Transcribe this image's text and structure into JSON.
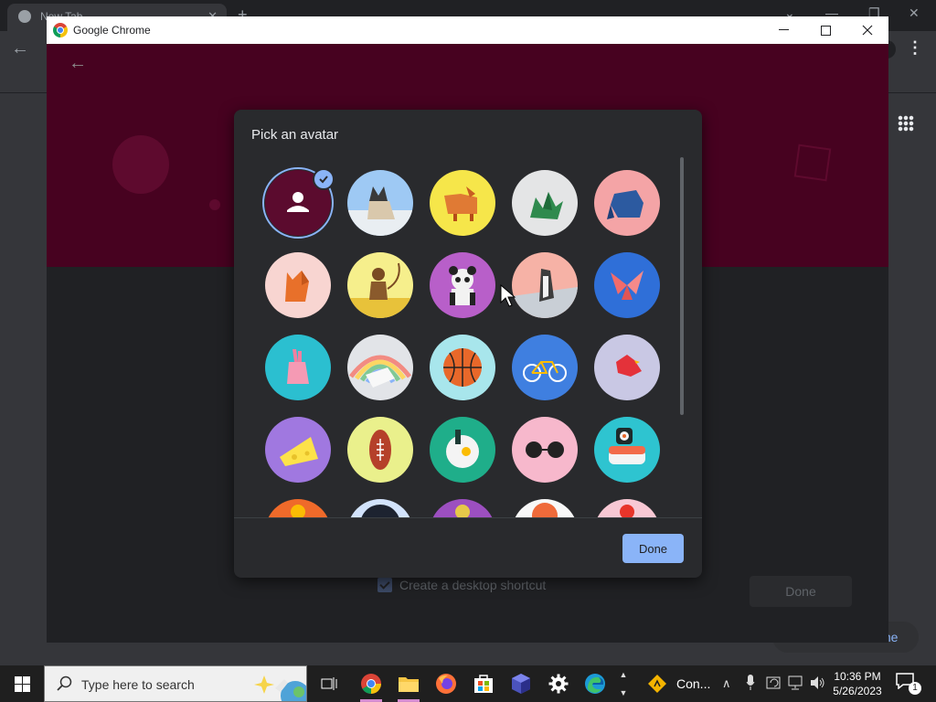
{
  "background_browser": {
    "tab_title": "New Tab",
    "profile_name_snippet": "me"
  },
  "window": {
    "title": "Google Chrome"
  },
  "profile_page": {
    "shortcut_label": "Create a desktop shortcut",
    "shortcut_checked": true,
    "done_label": "Done"
  },
  "dialog": {
    "title": "Pick an avatar",
    "done_label": "Done",
    "selected_index": 0,
    "avatars": [
      "generic-person",
      "cat",
      "corgi",
      "dragon",
      "elephant",
      "fox",
      "monkey",
      "panda",
      "penguin",
      "butterfly",
      "rabbit",
      "unicorn",
      "basketball",
      "bike",
      "bird",
      "cheese",
      "football",
      "ramen",
      "sunglasses",
      "sushi",
      "avatar-21",
      "avatar-22",
      "avatar-23",
      "avatar-24",
      "avatar-25"
    ]
  },
  "colors": {
    "accent": "#8ab4f8",
    "banner": "#470220",
    "dialog_bg": "#292a2d"
  },
  "taskbar": {
    "search_placeholder": "Type here to search",
    "app_label": "Con...",
    "clock_time": "10:36 PM",
    "clock_date": "5/26/2023",
    "notification_count": "1",
    "pinned": [
      "task-view",
      "chrome",
      "file-explorer",
      "firefox",
      "microsoft-store",
      "app-cube",
      "settings",
      "edge"
    ]
  }
}
